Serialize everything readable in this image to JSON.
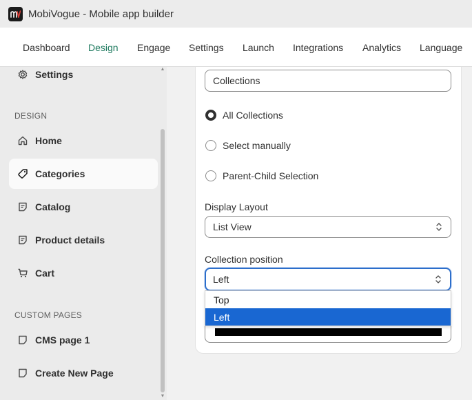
{
  "window": {
    "title": "MobiVogue - Mobile app builder",
    "logo_text": "mv"
  },
  "topnav": {
    "items": [
      {
        "label": "Dashboard"
      },
      {
        "label": "Design"
      },
      {
        "label": "Engage"
      },
      {
        "label": "Settings"
      },
      {
        "label": "Launch"
      },
      {
        "label": "Integrations"
      },
      {
        "label": "Analytics"
      },
      {
        "label": "Language"
      }
    ],
    "active": "Design"
  },
  "sidebar": {
    "top_item": {
      "label": "Settings",
      "icon": "gear-icon"
    },
    "design_section": "DESIGN",
    "design_items": [
      {
        "label": "Home",
        "icon": "home-icon"
      },
      {
        "label": "Categories",
        "icon": "tag-icon"
      },
      {
        "label": "Catalog",
        "icon": "note-icon"
      },
      {
        "label": "Product details",
        "icon": "note-icon"
      },
      {
        "label": "Cart",
        "icon": "cart-icon"
      }
    ],
    "active": "Categories",
    "custom_section": "CUSTOM PAGES",
    "custom_items": [
      {
        "label": "CMS page 1",
        "icon": "page-icon"
      },
      {
        "label": "Create New Page",
        "icon": "page-icon"
      }
    ]
  },
  "form": {
    "collections_field": {
      "value": "Collections"
    },
    "radios": [
      {
        "label": "All Collections",
        "checked": true
      },
      {
        "label": "Select manually",
        "checked": false
      },
      {
        "label": "Parent-Child Selection",
        "checked": false
      }
    ],
    "display_layout": {
      "label": "Display Layout",
      "value": "List View"
    },
    "collection_position": {
      "label": "Collection position",
      "value": "Left",
      "options": [
        "Top",
        "Left"
      ],
      "highlighted": "Left"
    }
  },
  "colors": {
    "accent": "#1e7a5f",
    "focus": "#2c6ecb",
    "selected_option": "#1967d2"
  }
}
